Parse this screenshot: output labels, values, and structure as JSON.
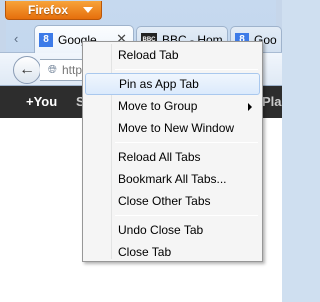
{
  "firefox_button": {
    "label": "Firefox"
  },
  "tabs": [
    {
      "label": "Google",
      "favicon": "8",
      "favicon_color": "#3d7be8",
      "active": true
    },
    {
      "label": "BBC - Hom",
      "favicon": "BBC",
      "favicon_color": "#222222",
      "active": false
    },
    {
      "label": "Goo",
      "favicon": "8",
      "favicon_color": "#3d7be8",
      "active": false
    }
  ],
  "urlbar": {
    "text": "http"
  },
  "google_bar": {
    "items": [
      "+You",
      "S",
      "Pla"
    ]
  },
  "context_menu": {
    "items": [
      {
        "label": "Reload Tab"
      },
      {
        "label": "Pin as App Tab",
        "highlighted": true
      },
      {
        "label": "Move to Group",
        "submenu": true
      },
      {
        "label": "Move to New Window"
      },
      {
        "label": "Reload All Tabs"
      },
      {
        "label": "Bookmark All Tabs..."
      },
      {
        "label": "Close Other Tabs"
      },
      {
        "label": "Undo Close Tab"
      },
      {
        "label": "Close Tab"
      }
    ]
  },
  "colors": {
    "firefox_orange": "#e66f0c",
    "menu_highlight": "#dbeafc",
    "google_bar": "#2d2d2d"
  }
}
